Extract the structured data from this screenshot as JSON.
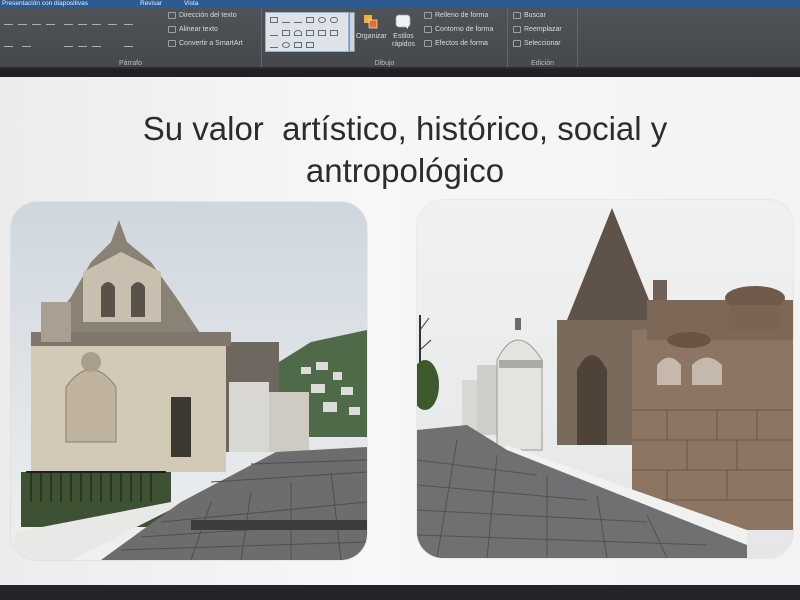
{
  "window": {
    "title_left": "Presentación con diapositivas",
    "tab_review": "Revisar",
    "tab_view": "Vista"
  },
  "ribbon": {
    "paragraph": {
      "text_direction": "Dirección del texto",
      "align_text": "Alinear texto",
      "convert_smartart": "Convertir a SmartArt",
      "label": "Párrafo"
    },
    "drawing": {
      "arrange": "Organizar",
      "quick_styles_line1": "Estilos",
      "quick_styles_line2": "rápidos",
      "shape_fill": "Relleno de forma",
      "shape_outline": "Contorno de forma",
      "shape_effects": "Efectos de forma",
      "label": "Dibujo"
    },
    "editing": {
      "find": "Buscar",
      "replace": "Reemplazar",
      "select": "Seleccionar",
      "label": "Edición"
    }
  },
  "slide": {
    "title": "Su valor  artístico, histórico, social y\nantropológico"
  },
  "colors": {
    "ribbon": "#4b4e52",
    "title_strip": "#2d5a8f",
    "slide_background": "#f3f3f3",
    "title_text": "#2c2c2c"
  },
  "icons": {
    "gallery": "shapes-gallery-icon",
    "arrange": "arrange-icon",
    "quick_styles": "quick-styles-icon",
    "fill": "paint-bucket-icon",
    "outline": "pen-outline-icon",
    "effects": "effects-icon",
    "find": "binoculars-icon",
    "replace": "replace-icon",
    "select": "cursor-select-icon"
  }
}
